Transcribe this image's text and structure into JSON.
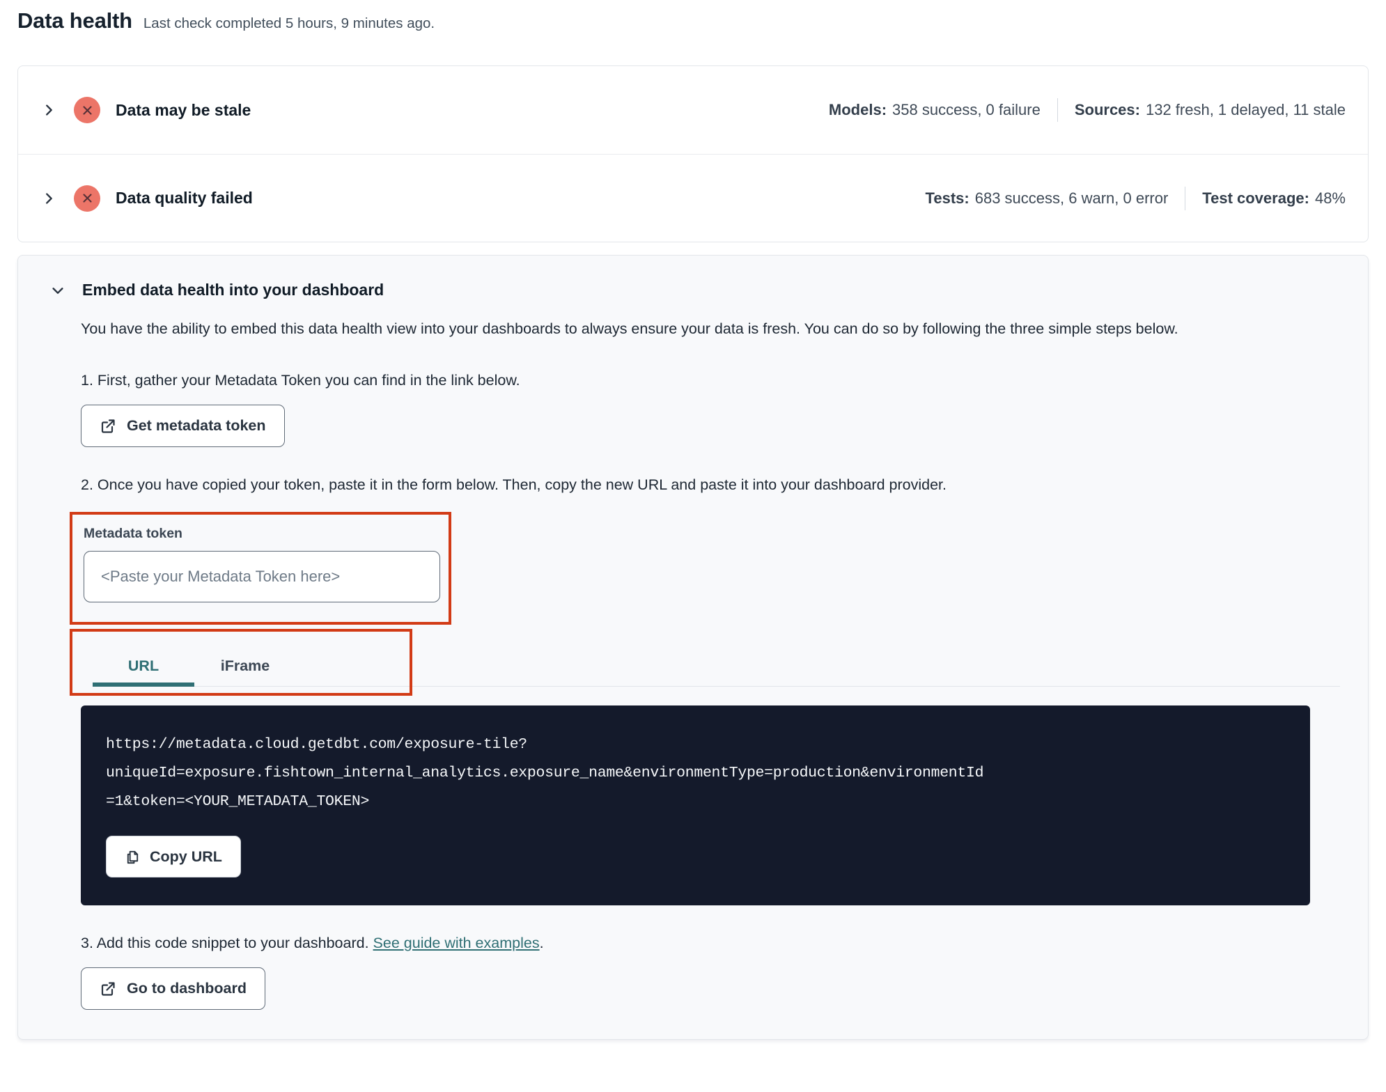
{
  "page": {
    "title": "Data health",
    "subtitle": "Last check completed 5 hours, 9 minutes ago."
  },
  "status_rows": [
    {
      "label": "Data may be stale",
      "status_icon": "error-x-icon",
      "stats": [
        {
          "name": "Models:",
          "value": "358 success, 0 failure"
        },
        {
          "name": "Sources:",
          "value": "132 fresh, 1 delayed, 11 stale"
        }
      ]
    },
    {
      "label": "Data quality failed",
      "status_icon": "error-x-icon",
      "stats": [
        {
          "name": "Tests:",
          "value": "683 success, 6 warn, 0 error"
        },
        {
          "name": "Test coverage:",
          "value": "48%"
        }
      ]
    }
  ],
  "embed": {
    "title": "Embed data health into your dashboard",
    "description": "You have the ability to embed this data health view into your dashboards to always ensure your data is fresh. You can do so by following the three simple steps below.",
    "step1": "1. First, gather your Metadata Token you can find in the link below.",
    "get_token_button": "Get metadata token",
    "step2": "2. Once you have copied your token, paste it in the form below. Then, copy the new URL and paste it into your dashboard provider.",
    "token_field": {
      "label": "Metadata token",
      "value": "",
      "placeholder": "<Paste your Metadata Token here>"
    },
    "tabs": [
      {
        "label": "URL",
        "active": true
      },
      {
        "label": "iFrame",
        "active": false
      }
    ],
    "code_url": "https://metadata.cloud.getdbt.com/exposure-tile?uniqueId=exposure.fishtown_internal_analytics.exposure_name&environmentType=production&environmentId=1&token=<YOUR_METADATA_TOKEN>",
    "code_lines": [
      "https://metadata.cloud.getdbt.com/exposure-tile?",
      "uniqueId=exposure.fishtown_internal_analytics.exposure_name&environmentType=production&environmentId",
      "=1&token=<YOUR_METADATA_TOKEN>"
    ],
    "copy_button": "Copy URL",
    "step3_prefix": "3. Add this code snippet to your dashboard. ",
    "step3_link": "See guide with examples",
    "step3_suffix": ".",
    "dashboard_button": "Go to dashboard"
  },
  "colors": {
    "accent_teal": "#2f6f74",
    "error_badge_bg": "#ec7568",
    "error_badge_x": "#573138",
    "annotation_red": "#d23b16",
    "code_block_bg": "#141a2b",
    "panel_bg": "#f8f9fb",
    "text_dark": "#101b26"
  },
  "icons": {
    "chevron_right": "chevron-right-icon",
    "chevron_down": "chevron-down-icon",
    "error_x": "error-x-icon",
    "external_link": "external-link-icon",
    "copy": "copy-icon"
  }
}
